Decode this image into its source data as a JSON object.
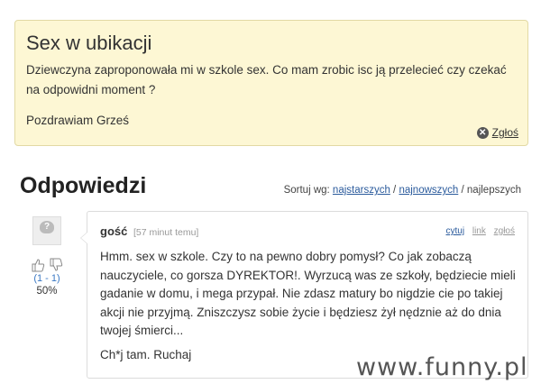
{
  "question": {
    "title": "Sex w ubikacji",
    "body": "Dziewczyna zaproponowała mi w szkole sex. Co mam zrobic isc ją przelecieć czy czekać na odpowidni moment ?",
    "signature": "Pozdrawiam Grześ",
    "report_label": "Zgłoś",
    "report_icon": "close-circle-icon"
  },
  "answers_section": {
    "heading": "Odpowiedzi",
    "sort_label": "Sortuj wg:",
    "sort_options": [
      "najstarszych",
      "najnowszych",
      "najlepszych"
    ],
    "separator": "/"
  },
  "answer": {
    "author": "gość",
    "time": "[57 minut temu]",
    "actions": {
      "quote": "cytuj",
      "link": "link",
      "report": "zgłoś"
    },
    "body": "Hmm. sex w szkole. Czy to na pewno dobry pomysł? Co jak zobaczą nauczyciele, co gorsza DYREKTOR!. Wyrzucą was ze szkoły, będziecie mieli gadanie w domu, i mega przypał. Nie zdasz matury bo nigdzie cie po takiej akcji nie przyjmą. Zniszczysz sobie życie i będziesz żył nędznie aż do dnia twojej śmierci...",
    "signature": "Ch*j tam. Ruchaj",
    "votes": {
      "count": "(1 - 1)",
      "percent": "50%"
    }
  },
  "watermark": "www.funny.pl",
  "colors": {
    "question_bg": "#fdf7d4",
    "link": "#2a5a9c",
    "vote_count": "#3a78c4"
  }
}
